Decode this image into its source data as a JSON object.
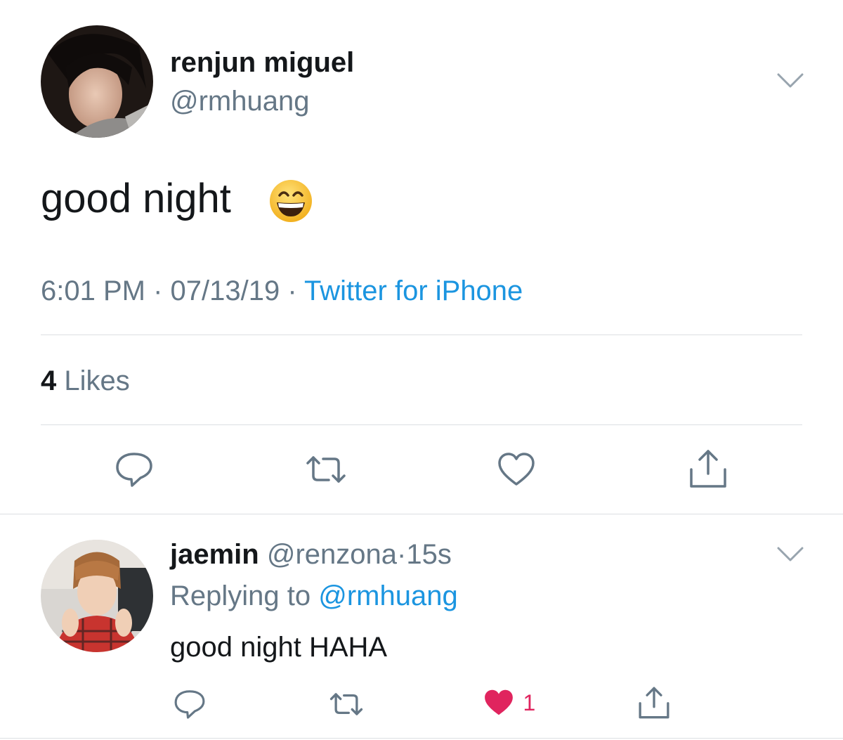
{
  "main_tweet": {
    "display_name": "renjun miguel",
    "handle": "@rmhuang",
    "text": "good night",
    "emoji": "grinning-face-with-smiling-eyes",
    "time": "6:01 PM",
    "date": "07/13/19",
    "source": "Twitter for iPhone",
    "likes_count": "4",
    "likes_label": "Likes",
    "actions": [
      "reply-icon",
      "retweet-icon",
      "like-icon",
      "share-icon"
    ]
  },
  "reply_tweet": {
    "display_name": "jaemin",
    "handle": "@renzona",
    "time_ago": "15s",
    "replying_label": "Replying to",
    "replying_handle": "@rmhuang",
    "text": "good night HAHA",
    "like_count": "1",
    "liked": true,
    "actions": [
      "reply-icon",
      "retweet-icon",
      "liked-heart-icon",
      "share-icon"
    ]
  },
  "colors": {
    "text": "#14171a",
    "secondary": "#657786",
    "link": "#1b95e0",
    "like": "#e0245e",
    "divider": "#dcdfe2"
  }
}
